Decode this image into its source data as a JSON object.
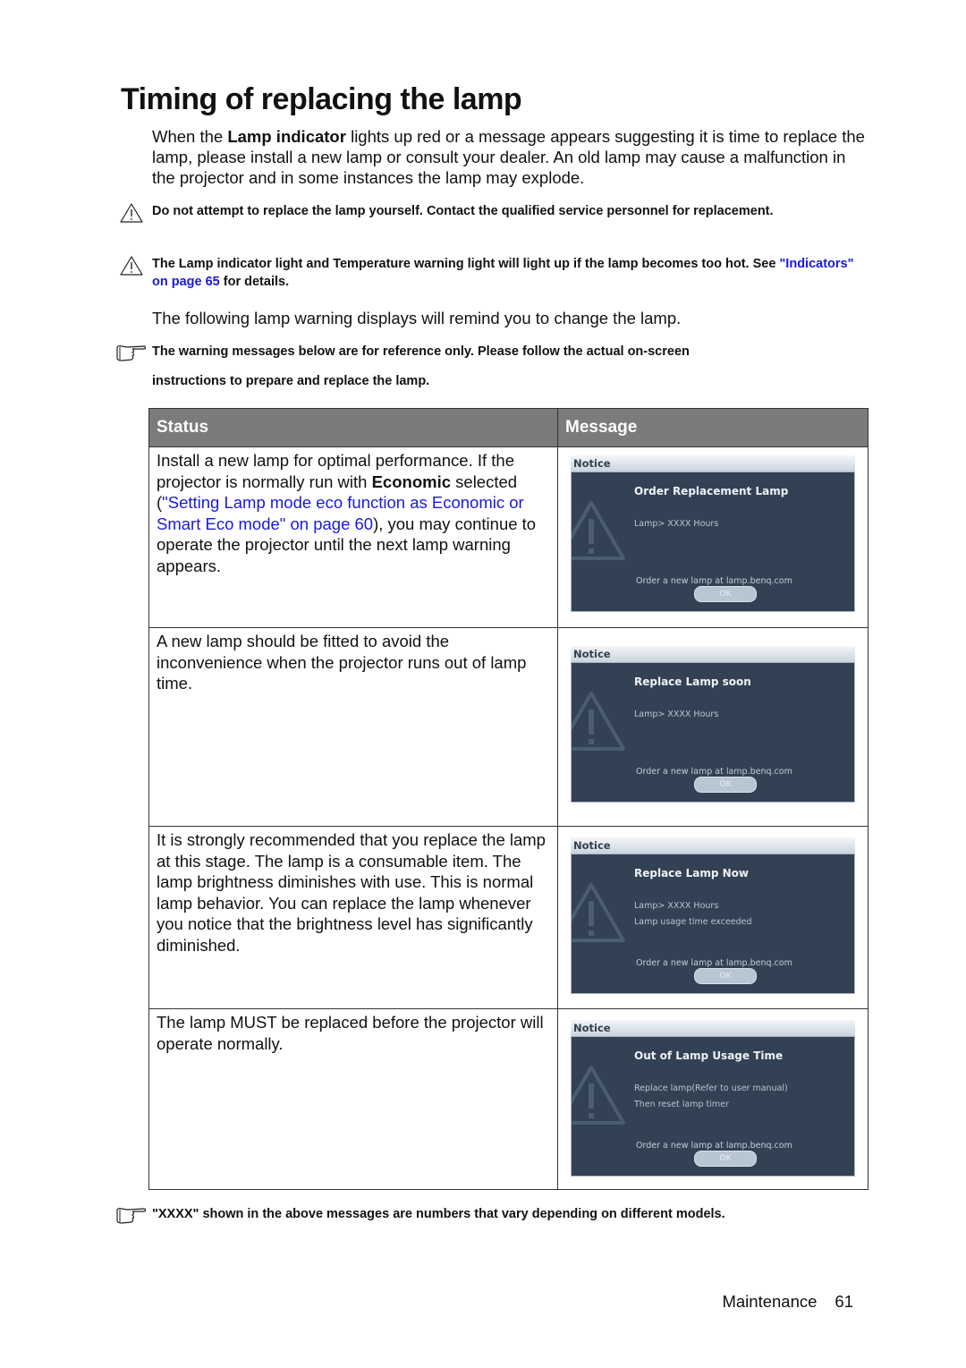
{
  "title": "Timing of replacing the lamp",
  "intro": {
    "before_bold": "When the ",
    "bold": "Lamp indicator",
    "after_bold": " lights up red or a message appears suggesting it is time to replace the lamp, please install a new lamp or consult your dealer. An old lamp may cause a malfunction in the projector and in some instances the lamp may explode."
  },
  "warnings": [
    {
      "icon": "warning-triangle-icon",
      "text": "Do not attempt to replace the lamp yourself. Contact the qualified service personnel for replacement."
    },
    {
      "icon": "warning-triangle-icon",
      "text_before": "The Lamp indicator light and Temperature warning light will light up if the lamp becomes too hot. See ",
      "link": "\"Indicators\" on page 65",
      "text_after": " for details."
    }
  ],
  "following": "The following lamp warning displays will remind you to change the lamp.",
  "reference_note": {
    "icon": "pointing-hand-icon",
    "line1": "The warning messages below are for reference only. Please follow the actual on-screen",
    "line2": "instructions to prepare and replace the lamp."
  },
  "table": {
    "headers": {
      "status": "Status",
      "message": "Message"
    },
    "rows": [
      {
        "status_p1": "Install a new lamp for optimal performance. If the projector is normally run with ",
        "status_bold": "Economic",
        "status_p2": " selected (",
        "status_link": "\"Setting Lamp mode eco function as Economic or Smart Eco mode\" on page 60",
        "status_p3": "), you may continue to operate the projector until the next lamp warning appears.",
        "notice": {
          "bar": "Notice",
          "heading": "Order Replacement Lamp",
          "line1": "Lamp> XXXX Hours",
          "line2": "",
          "order": "Order a new lamp at lamp.benq.com",
          "ok": "OK"
        }
      },
      {
        "status": "A new lamp should be fitted to avoid the inconvenience when the projector runs out of lamp time.",
        "notice": {
          "bar": "Notice",
          "heading": "Replace Lamp soon",
          "line1": "Lamp> XXXX Hours",
          "line2": "",
          "order": "Order a new lamp at lamp.benq.com",
          "ok": "OK"
        }
      },
      {
        "status": "It is strongly recommended that you replace the lamp at this stage. The lamp is a consumable item. The lamp brightness diminishes with use. This is normal lamp behavior. You can replace the lamp whenever you notice that the brightness level has significantly diminished.",
        "notice": {
          "bar": "Notice",
          "heading": "Replace Lamp Now",
          "line1": "Lamp> XXXX Hours",
          "line2": "Lamp usage time exceeded",
          "order": "Order a new lamp at lamp.benq.com",
          "ok": "OK"
        }
      },
      {
        "status": "The lamp MUST be replaced before the projector will operate normally.",
        "notice": {
          "bar": "Notice",
          "heading": "Out of Lamp Usage Time",
          "line1": "Replace lamp(Refer to user manual)",
          "line2": "Then reset lamp timer",
          "order": "Order a new lamp at lamp.benq.com",
          "ok": "OK"
        }
      }
    ]
  },
  "xxxx_note": {
    "icon": "pointing-hand-icon",
    "text": "\"XXXX\" shown in the above messages are numbers that vary depending on different models."
  },
  "footer": {
    "section": "Maintenance",
    "page": "61"
  },
  "colors": {
    "link": "#1a1adc",
    "header_bg": "#7b7b7b",
    "notice_bg": "#334155"
  }
}
